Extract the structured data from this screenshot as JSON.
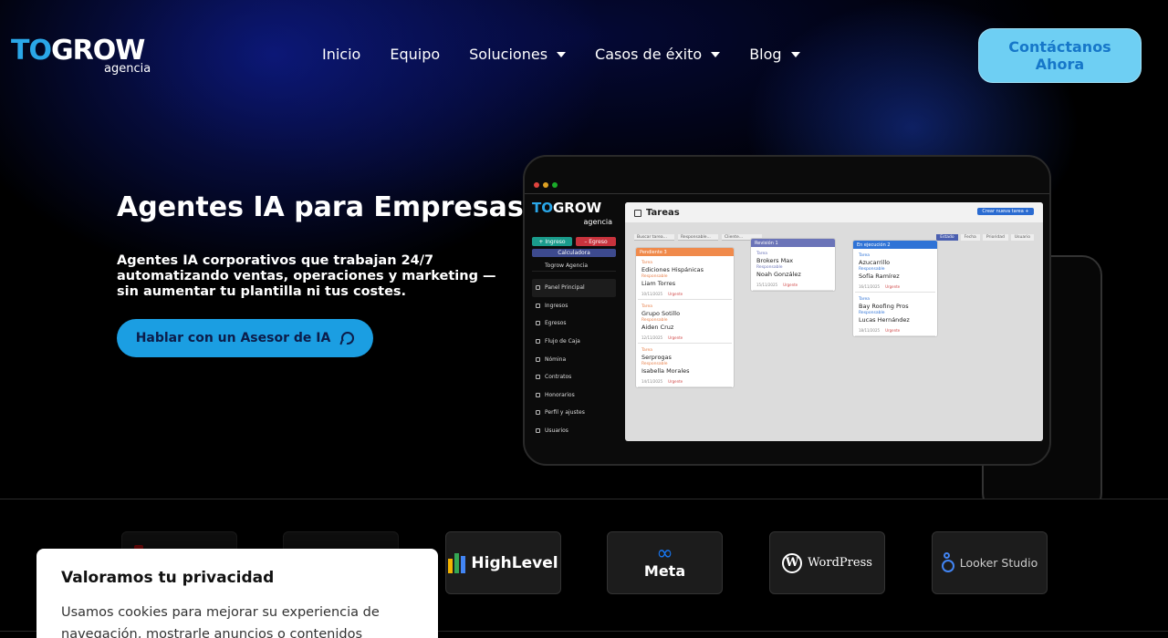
{
  "header": {
    "logo": {
      "to": "TO",
      "grow": "GROW",
      "sub": "agencia"
    },
    "nav": [
      {
        "label": "Inicio",
        "has_dropdown": false
      },
      {
        "label": "Equipo",
        "has_dropdown": false
      },
      {
        "label": "Soluciones",
        "has_dropdown": true
      },
      {
        "label": "Casos de éxito",
        "has_dropdown": true
      },
      {
        "label": "Blog",
        "has_dropdown": true
      }
    ],
    "cta_label": "Contáctanos Ahora"
  },
  "hero": {
    "title": "Agentes IA para Empresas",
    "description": "Agentes IA corporativos que trabajan 24/7 automatizando ventas, operaciones y marketing — sin aumentar tu plantilla ni tus costes.",
    "button_label": "Hablar con un Asesor de IA"
  },
  "mockup": {
    "logo": {
      "to": "TO",
      "grow": "GROW",
      "sub": "agencia"
    },
    "btn_ingreso": "+ Ingreso",
    "btn_egreso": "– Egreso",
    "calculadora": "Calculadora",
    "agency_name": "Togrow Agencia",
    "menu": [
      "Panel Principal",
      "Ingresos",
      "Egresos",
      "Flujo de Caja",
      "Nómina",
      "Contratos",
      "Honorarios",
      "Perfil y ajustes",
      "Usuarios"
    ],
    "page_title": "Tareas",
    "new_task": "Crear nueva tarea +",
    "filters": [
      "Buscar tarea...",
      "Responsable...",
      "Cliente..."
    ],
    "tabs": [
      "Estado",
      "Fecha",
      "Prioridad",
      "Usuario"
    ],
    "columns": [
      {
        "title": "Pendiente",
        "count": "3",
        "color": "#f08a4b",
        "cards": [
          {
            "tarea_label": "Tarea",
            "tarea": "Ediciones Hispánicas",
            "resp_label": "Responsable",
            "resp": "Liam Torres",
            "date": "10/11/2025",
            "tag": "Urgente"
          },
          {
            "tarea_label": "Tarea",
            "tarea": "Grupo Sotillo",
            "resp_label": "Responsable",
            "resp": "Aiden Cruz",
            "date": "12/11/2025",
            "tag": "Urgente"
          },
          {
            "tarea_label": "Tarea",
            "tarea": "Serprogas",
            "resp_label": "Responsable",
            "resp": "Isabella Morales",
            "date": "14/11/2025",
            "tag": "Urgente"
          }
        ]
      },
      {
        "title": "Revisión",
        "count": "1",
        "color": "#6b74b8",
        "cards": [
          {
            "tarea_label": "Tarea",
            "tarea": "Brokers Max",
            "resp_label": "Responsable",
            "resp": "Noah González",
            "date": "15/11/2025",
            "tag": "Urgente"
          }
        ]
      },
      {
        "title": "En ejecución",
        "count": "2",
        "color": "#2f73d6",
        "cards": [
          {
            "tarea_label": "Tarea",
            "tarea": "Azucarrillo",
            "resp_label": "Responsable",
            "resp": "Sofía Ramírez",
            "date": "16/11/2025",
            "tag": "Urgente"
          },
          {
            "tarea_label": "Tarea",
            "tarea": "Bay Roofing Pros",
            "resp_label": "Responsable",
            "resp": "Lucas Hernández",
            "date": "18/11/2025",
            "tag": "Urgente"
          }
        ]
      }
    ]
  },
  "brands": [
    {
      "name": "",
      "icon": "partial-red-logo"
    },
    {
      "name": "",
      "icon": "partial-gray-logo"
    },
    {
      "name": "HighLevel",
      "icon": "highlevel-icon"
    },
    {
      "name": "Meta",
      "icon": "meta-icon"
    },
    {
      "name": "WordPress",
      "icon": "wordpress-icon"
    },
    {
      "name": "Looker Studio",
      "icon": "looker-studio-icon"
    }
  ],
  "cookie": {
    "title": "Valoramos tu privacidad",
    "text": "Usamos cookies para mejorar su experiencia de navegación, mostrarle anuncios o contenidos"
  },
  "colors": {
    "accent": "#1b9ee2",
    "cta": "#6ecff3",
    "background": "#000000"
  }
}
